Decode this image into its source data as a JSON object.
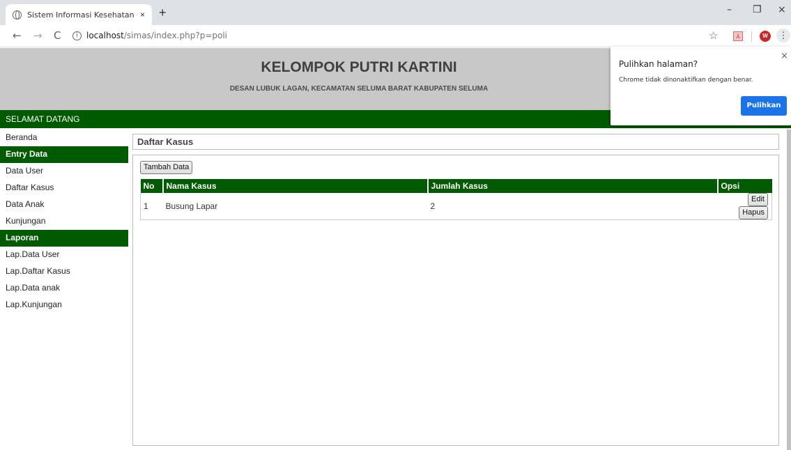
{
  "browser": {
    "tab_title": "Sistem Informasi Kesehatan Gizi A",
    "tab_close": "×",
    "new_tab": "+",
    "minimize": "–",
    "restore": "❐",
    "close": "×",
    "back": "←",
    "forward": "→",
    "reload": "C",
    "info": "i",
    "url_host": "localhost",
    "url_path": "/simas/index.php?p=poli",
    "bookmark": "☆",
    "profile_initial": "W",
    "menu": "⋮",
    "pdf": "⅄"
  },
  "header": {
    "title": "KELOMPOK PUTRI KARTINI",
    "subtitle": "DESAN LUBUK LAGAN, KECAMATAN SELUMA BARAT KABUPATEN SELUMA"
  },
  "welcome": "SELAMAT DATANG",
  "sidebar": {
    "beranda": "Beranda",
    "entry_head": "Entry Data",
    "entry_items": [
      "Data User",
      "Daftar Kasus",
      "Data Anak",
      "Kunjungan"
    ],
    "laporan_head": "Laporan",
    "laporan_items": [
      "Lap.Data User",
      "Lap.Daftar Kasus",
      "Lap.Data anak",
      "Lap.Kunjungan"
    ]
  },
  "main": {
    "section_title": "Daftar Kasus",
    "add_button": "Tambah Data",
    "table": {
      "headers": [
        "No",
        "Nama Kasus",
        "Jumlah Kasus",
        "Opsi"
      ],
      "rows": [
        {
          "no": "1",
          "nama": "Busung Lapar",
          "jumlah": "2",
          "edit": "Edit",
          "hapus": "Hapus"
        }
      ]
    }
  },
  "popup": {
    "title": "Pulihkan halaman?",
    "message": "Chrome tidak dinonaktifkan dengan benar.",
    "button": "Pulihkan",
    "close": "×"
  }
}
